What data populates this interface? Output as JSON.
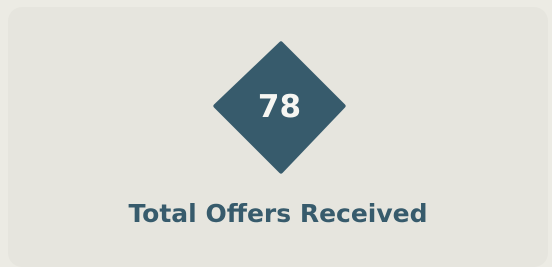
{
  "stat": {
    "value": "78",
    "label": "Total Offers Received"
  },
  "colors": {
    "accent": "#375b6c",
    "card": "#e6e5de",
    "background": "#ecebe4"
  }
}
